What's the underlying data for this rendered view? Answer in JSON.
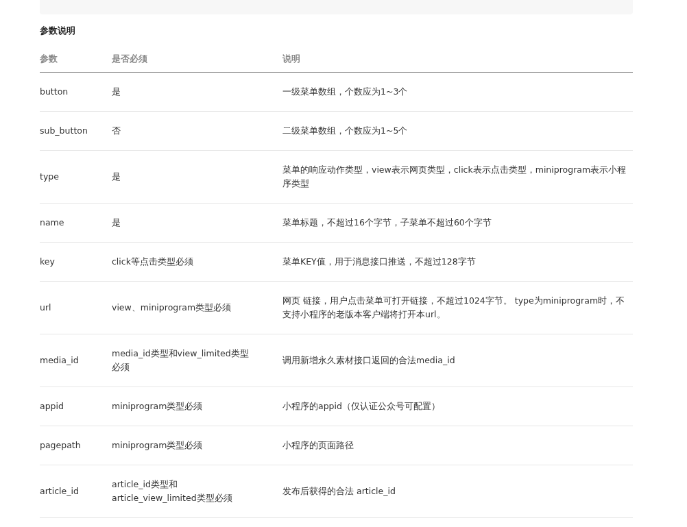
{
  "section_title": "参数说明",
  "table": {
    "columns": [
      "参数",
      "是否必须",
      "说明"
    ],
    "rows": [
      [
        "button",
        "是",
        "一级菜单数组，个数应为1~3个"
      ],
      [
        "sub_button",
        "否",
        "二级菜单数组，个数应为1~5个"
      ],
      [
        "type",
        "是",
        "菜单的响应动作类型，view表示网页类型，click表示点击类型，miniprogram表示小程序类型"
      ],
      [
        "name",
        "是",
        "菜单标题，不超过16个字节，子菜单不超过60个字节"
      ],
      [
        "key",
        "click等点击类型必须",
        "菜单KEY值，用于消息接口推送，不超过128字节"
      ],
      [
        "url",
        "view、miniprogram类型必须",
        "网页 链接，用户点击菜单可打开链接，不超过1024字节。 type为miniprogram时，不支持小程序的老版本客户端将打开本url。"
      ],
      [
        "media_id",
        "media_id类型和view_limited类型必须",
        "调用新增永久素材接口返回的合法media_id"
      ],
      [
        "appid",
        "miniprogram类型必须",
        "小程序的appid（仅认证公众号可配置）"
      ],
      [
        "pagepath",
        "miniprogram类型必须",
        "小程序的页面路径"
      ],
      [
        "article_id",
        "article_id类型和article_view_limited类型必须",
        "发布后获得的合法 article_id"
      ]
    ]
  }
}
